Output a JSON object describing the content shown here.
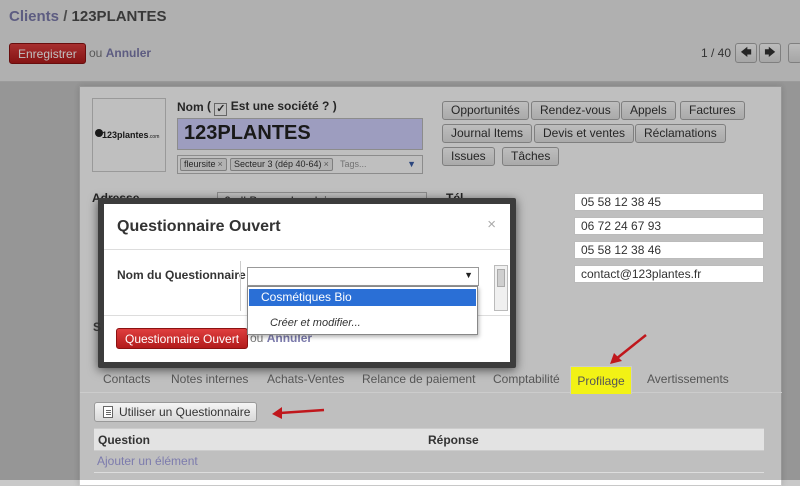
{
  "header": {
    "breadcrumb_parent": "Clients",
    "breadcrumb_sep": "/",
    "breadcrumb_current": "123PLANTES",
    "save_label": "Enregistrer",
    "or_text": "ou",
    "cancel_label": "Annuler",
    "pager_text": "1 / 40",
    "prev_glyph": "🡄",
    "next_glyph": "🡆"
  },
  "form": {
    "logo_text": "123plantes",
    "logo_suffix": ".com",
    "name_label": "Nom",
    "is_company_label": "Est une société ?",
    "is_company_checked": "✓",
    "open_paren": "(",
    "close_paren": ")",
    "company_name": "123PLANTES",
    "tags": [
      "fleursite",
      "Secteur 3 (dép 40-64)"
    ],
    "tag_remove": "×",
    "tags_placeholder": "Tags...",
    "tags_caret": "▼",
    "smart_buttons_row1": [
      "Opportunités",
      "Rendez-vous",
      "Appels",
      "Factures"
    ],
    "smart_buttons_row2": [
      "Journal Items",
      "Devis et ventes",
      "Réclamations"
    ],
    "smart_buttons_row3": [
      "Issues",
      "Tâches"
    ],
    "address_label": "Adresse",
    "address_value": "6 all Berges Landaises",
    "phone_label": "Tél.",
    "contact_values": [
      "05 58 12 38 45",
      "06 72 24 67 93",
      "05 58 12 38 46",
      "contact@123plantes.fr"
    ],
    "peek_label_s": "S"
  },
  "tabs": {
    "items": [
      "Contacts",
      "Notes internes",
      "Achats-Ventes",
      "Relance de paiement",
      "Comptabilité"
    ],
    "active": "Profilage",
    "after": "Avertissements"
  },
  "profilage": {
    "tool_button": "Utiliser un Questionnaire",
    "col_question": "Question",
    "col_answer": "Réponse",
    "add_item": "Ajouter un élément"
  },
  "modal": {
    "title": "Questionnaire Ouvert",
    "close_glyph": "×",
    "field_label": "Nom du Questionnaire",
    "select_value": "",
    "select_caret": "▼",
    "dropdown_options": [
      "Cosmétiques Bio"
    ],
    "create_edit": "Créer et modifier...",
    "primary_button": "Questionnaire Ouvert",
    "or_text": "ou",
    "cancel_label": "Annuler"
  },
  "colors": {
    "accent_red": "#b21b1b",
    "link": "#7c7bad",
    "active_tab_highlight": "#f2f215",
    "selected_option": "#2a6fd6",
    "name_field_bg": "#d2d2ff",
    "annotation_arrow": "#c0171c"
  }
}
